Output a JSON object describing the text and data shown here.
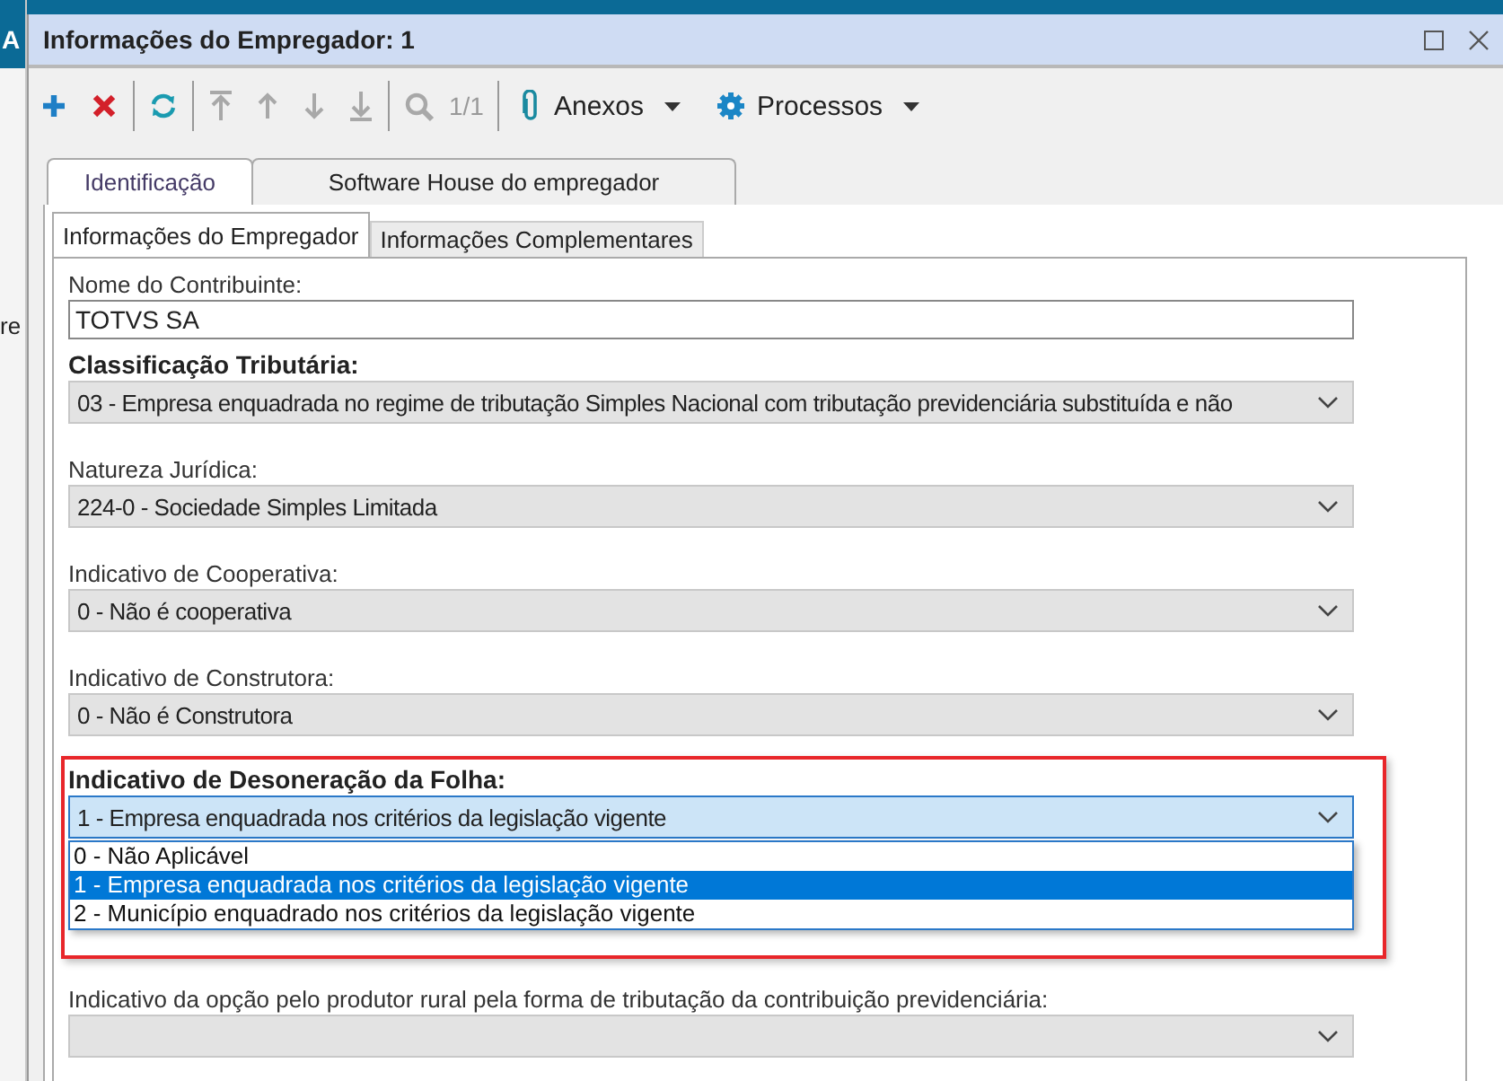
{
  "background_window": {
    "texts": [
      "A",
      "re"
    ]
  },
  "window": {
    "title": "Informações do Empregador: 1"
  },
  "toolbar": {
    "buttons": [
      {
        "kind": "add",
        "disabled": false
      },
      {
        "kind": "delete",
        "disabled": false
      },
      {
        "kind": "refresh",
        "disabled": false
      },
      {
        "kind": "first",
        "disabled": true
      },
      {
        "kind": "previous",
        "disabled": true
      },
      {
        "kind": "next",
        "disabled": true
      },
      {
        "kind": "last",
        "disabled": true
      },
      {
        "kind": "search",
        "disabled": true
      }
    ],
    "record_counter": "1/1",
    "menus": [
      {
        "kind": "attachments",
        "label": "Anexos"
      },
      {
        "kind": "processes",
        "label": "Processos"
      }
    ]
  },
  "tabs": [
    {
      "label": "Identificação",
      "selected": true
    },
    {
      "label": "Software House do empregador",
      "selected": false
    }
  ],
  "subtabs": [
    {
      "label": "Informações do Empregador",
      "selected": true
    },
    {
      "label": "Informações Complementares",
      "selected": false
    }
  ],
  "fields": [
    {
      "kind": "text",
      "label": "Nome do Contribuinte:",
      "bold": false,
      "value": "TOTVS SA",
      "highlighted": false
    },
    {
      "kind": "select",
      "label": "Classificação Tributária:",
      "bold": true,
      "value": "03 - Empresa enquadrada no regime de tributação Simples Nacional com tributação previdenciária substituída e não",
      "highlighted": false
    },
    {
      "kind": "select",
      "label": "Natureza Jurídica:",
      "bold": false,
      "value": "224-0 - Sociedade Simples Limitada",
      "highlighted": false
    },
    {
      "kind": "select",
      "label": "Indicativo de Cooperativa:",
      "bold": false,
      "value": "0 - Não é cooperativa",
      "highlighted": false
    },
    {
      "kind": "select",
      "label": "Indicativo de Construtora:",
      "bold": false,
      "value": "0 - Não é Construtora",
      "highlighted": false
    },
    {
      "kind": "select",
      "label": "Indicativo de Desoneração da Folha:",
      "bold": true,
      "value": "1 - Empresa enquadrada nos critérios da legislação vigente",
      "highlighted": true,
      "expanded": true,
      "options": [
        {
          "label": "0 - Não Aplicável",
          "selected": false
        },
        {
          "label": "1 - Empresa enquadrada nos critérios da legislação vigente",
          "selected": true
        },
        {
          "label": "2 - Município enquadrado nos critérios da legislação vigente",
          "selected": false
        }
      ]
    },
    {
      "kind": "select",
      "label": "Indicativo da opção pelo produtor rural pela forma de tributação da contribuição previdenciária:",
      "bold": false,
      "highlighted": false
    }
  ]
}
